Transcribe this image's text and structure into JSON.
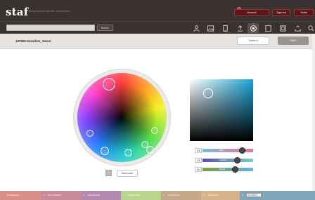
{
  "header": {
    "logo": "staf",
    "tagline": "Bring visions to life with Shutterstock",
    "account_label": "Account",
    "signout_label": "Sign out",
    "help_label": "Guide"
  },
  "search": {
    "value": "",
    "button_label": "Search"
  },
  "nav_icons": [
    "user-icon",
    "image-icon",
    "phone-icon",
    "upload-icon",
    "color-wheel-icon",
    "frame-icon",
    "device-icon",
    "share-icon",
    "search-icon"
  ],
  "palette_title": "197655-Sensitive_Sweet",
  "visibility_select": "Visible ▾",
  "save_label": "SAVE",
  "harmony_label": "Harmonize",
  "sliders": [
    {
      "value": "198",
      "channel": "RED",
      "level": 0.78,
      "gradient": [
        "#7ac0d8",
        "#e870a0"
      ]
    },
    {
      "value": "176",
      "channel": "GREEN",
      "level": 0.69,
      "gradient": [
        "#5a4ab0",
        "#78d0c0"
      ]
    },
    {
      "value": "164",
      "channel": "BLUE",
      "level": 0.64,
      "gradient": [
        "#78a040",
        "#6ab0e8"
      ]
    }
  ],
  "swatches": [
    {
      "label": "ROSEQUAN",
      "color": "#d98f86",
      "has_x": false
    },
    {
      "label": "SKY GUARDI",
      "color": "#c98a9a",
      "has_x": true
    },
    {
      "label": "MAUVESHE",
      "color": "#b58ab0",
      "has_x": true
    },
    {
      "label": "WHITE SHE",
      "color": "#b9d48c",
      "has_x": true
    },
    {
      "label": "AQUAMAYA",
      "color": "#c6a88a",
      "has_x": true
    },
    {
      "label": "APRICENT",
      "color": "#d7b28a",
      "has_x": true
    },
    {
      "label": "SKYMAYO",
      "color": "#7fa6b8",
      "has_x": true,
      "input_value": "SKYMAYO"
    }
  ],
  "colors": {
    "header_bg": "#3a3230",
    "accent_red": "#5c1616",
    "sv_hue": "#19a2d6"
  }
}
